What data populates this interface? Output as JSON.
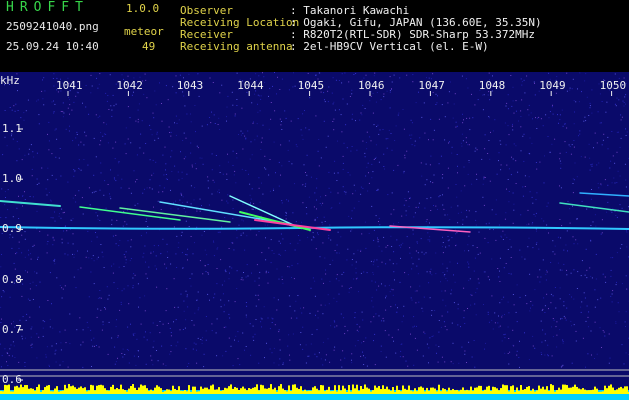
{
  "header": {
    "app_name": "HROFFT",
    "version": "1.0.0",
    "filename": "2509241040.png",
    "datetime": "25.09.24 10:40",
    "count_label": "meteor",
    "count_value": "49"
  },
  "info": {
    "observer_label": "Observer",
    "observer_value": ": Takanori Kawachi",
    "location_label": "Receiving Location",
    "location_value": ": Ogaki, Gifu, JAPAN (136.60E, 35.35N)",
    "receiver_label": "Receiver",
    "receiver_value": ": R820T2(RTL-SDR) SDR-Sharp 53.372MHz",
    "antenna_label": "Receiving antenna",
    "antenna_value": ": 2el-HB9CV Vertical (el. E-W)"
  },
  "axes": {
    "unit": "kHz",
    "x_ticks": [
      "1041",
      "1042",
      "1043",
      "1044",
      "1045",
      "1046",
      "1047",
      "1048",
      "1049",
      "1050"
    ],
    "y_ticks": [
      "1.1",
      "1.0",
      "0.9",
      "0.8",
      "0.7",
      "0.6"
    ]
  },
  "colors": {
    "background": "#0a0a6a",
    "echo_line": "#30c8ff",
    "meteor_bright": "#ff40a0",
    "bottom_bar": "#00d0ff",
    "bottom_peaks": "#ffff00"
  }
}
